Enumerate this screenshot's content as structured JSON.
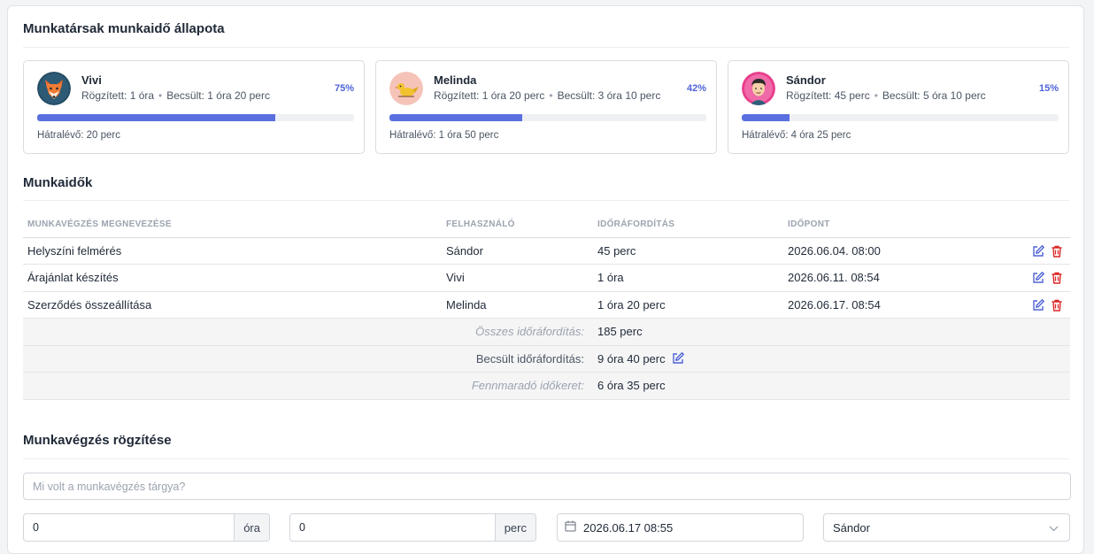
{
  "status": {
    "title": "Munkatársak munkaidő állapota",
    "cards": [
      {
        "name": "Vivi",
        "recorded": "Rögzített: 1 óra",
        "estimated": "Becsült: 1 óra 20 perc",
        "percent_label": "75%",
        "progress": 0.75,
        "remaining": "Hátralévő: 20 perc",
        "avatar": "fox-avatar-icon"
      },
      {
        "name": "Melinda",
        "recorded": "Rögzített: 1 óra 20 perc",
        "estimated": "Becsült: 3 óra 10 perc",
        "percent_label": "42%",
        "progress": 0.42,
        "remaining": "Hátralévő: 1 óra 50 perc",
        "avatar": "bird-avatar-icon"
      },
      {
        "name": "Sándor",
        "recorded": "Rögzített: 45 perc",
        "estimated": "Becsült: 5 óra 10 perc",
        "percent_label": "15%",
        "progress": 0.15,
        "remaining": "Hátralévő: 4 óra 25 perc",
        "avatar": "man-avatar-icon"
      }
    ]
  },
  "worktimes": {
    "title": "Munkaidők",
    "columns": [
      "MUNKAVÉGZÉS MEGNEVEZÉSE",
      "FELHASZNÁLÓ",
      "IDŐRÁFORDÍTÁS",
      "IDŐPONT"
    ],
    "rows": [
      {
        "task": "Helyszíni felmérés",
        "user": "Sándor",
        "time": "45 perc",
        "date": "2026.06.04. 08:00"
      },
      {
        "task": "Árajánlat készítés",
        "user": "Vivi",
        "time": "1 óra",
        "date": "2026.06.11. 08:54"
      },
      {
        "task": "Szerződés összeállítása",
        "user": "Melinda",
        "time": "1 óra 20 perc",
        "date": "2026.06.17. 08:54"
      }
    ],
    "summary": {
      "total_label": "Összes időráfordítás:",
      "total_value": "185 perc",
      "estimated_label": "Becsült időráfordítás:",
      "estimated_value": "9 óra 40 perc",
      "remaining_label": "Fennmaradó időkeret:",
      "remaining_value": "6 óra 35 perc"
    }
  },
  "record": {
    "title": "Munkavégzés rögzítése",
    "subject_placeholder": "Mi volt a munkavégzés tárgya?",
    "hours_value": "0",
    "hours_unit": "óra",
    "minutes_value": "0",
    "minutes_unit": "perc",
    "datetime_value": "2026.06.17 08:55",
    "user_selected": "Sándor"
  },
  "colors": {
    "accent": "#5a6fe0",
    "danger": "#dc2626"
  }
}
